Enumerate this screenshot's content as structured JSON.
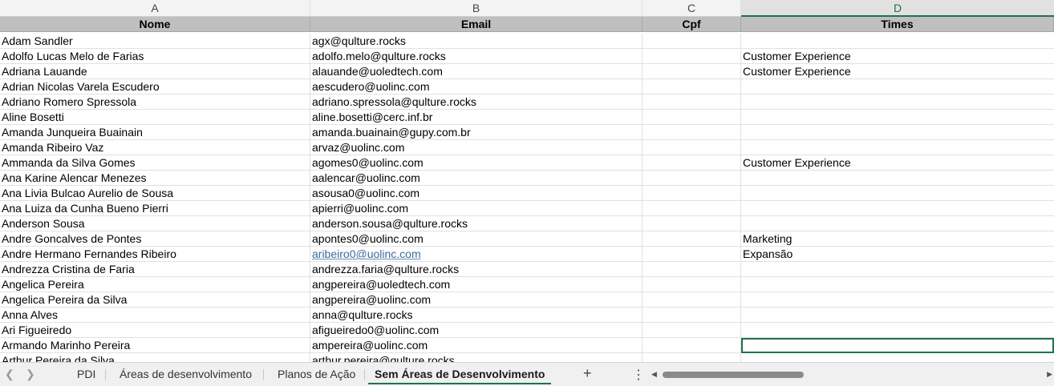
{
  "columns": [
    "A",
    "B",
    "C",
    "D"
  ],
  "header": {
    "nome": "Nome",
    "email": "Email",
    "cpf": "Cpf",
    "times": "Times"
  },
  "rows": [
    {
      "nome": "Adam Sandler",
      "email": "agx@qulture.rocks",
      "cpf": "",
      "times": ""
    },
    {
      "nome": "Adolfo Lucas Melo de Farias",
      "email": "adolfo.melo@qulture.rocks",
      "cpf": "",
      "times": "Customer Experience"
    },
    {
      "nome": "Adriana Lauande",
      "email": "alauande@uoledtech.com",
      "cpf": "",
      "times": "Customer Experience"
    },
    {
      "nome": "Adrian Nicolas Varela Escudero",
      "email": "aescudero@uolinc.com",
      "cpf": "",
      "times": ""
    },
    {
      "nome": "Adriano Romero Spressola",
      "email": "adriano.spressola@qulture.rocks",
      "cpf": "",
      "times": ""
    },
    {
      "nome": "Aline Bosetti",
      "email": "aline.bosetti@cerc.inf.br",
      "cpf": "",
      "times": ""
    },
    {
      "nome": "Amanda Junqueira Buainain",
      "email": "amanda.buainain@gupy.com.br",
      "cpf": "",
      "times": ""
    },
    {
      "nome": "Amanda Ribeiro Vaz",
      "email": "arvaz@uolinc.com",
      "cpf": "",
      "times": ""
    },
    {
      "nome": "Ammanda da Silva Gomes",
      "email": "agomes0@uolinc.com",
      "cpf": "",
      "times": "Customer Experience"
    },
    {
      "nome": "Ana Karine Alencar Menezes",
      "email": "aalencar@uolinc.com",
      "cpf": "",
      "times": ""
    },
    {
      "nome": "Ana Livia Bulcao Aurelio de Sousa",
      "email": "asousa0@uolinc.com",
      "cpf": "",
      "times": ""
    },
    {
      "nome": "Ana Luiza da Cunha Bueno Pierri",
      "email": "apierri@uolinc.com",
      "cpf": "",
      "times": ""
    },
    {
      "nome": "Anderson Sousa",
      "email": "anderson.sousa@qulture.rocks",
      "cpf": "",
      "times": ""
    },
    {
      "nome": "Andre Goncalves de Pontes",
      "email": "apontes0@uolinc.com",
      "cpf": "",
      "times": "Marketing"
    },
    {
      "nome": "Andre Hermano Fernandes Ribeiro",
      "email": "aribeiro0@uolinc.com",
      "cpf": "",
      "times": "Expansão"
    },
    {
      "nome": "Andrezza Cristina de Faria",
      "email": "andrezza.faria@qulture.rocks",
      "cpf": "",
      "times": ""
    },
    {
      "nome": "Angelica Pereira",
      "email": "angpereira@uoledtech.com",
      "cpf": "",
      "times": ""
    },
    {
      "nome": "Angelica Pereira da Silva",
      "email": "angpereira@uolinc.com",
      "cpf": "",
      "times": ""
    },
    {
      "nome": "Anna Alves",
      "email": "anna@qulture.rocks",
      "cpf": "",
      "times": ""
    },
    {
      "nome": "Ari Figueiredo",
      "email": "afigueiredo0@uolinc.com",
      "cpf": "",
      "times": ""
    },
    {
      "nome": "Armando Marinho Pereira",
      "email": "ampereira@uolinc.com",
      "cpf": "",
      "times": ""
    },
    {
      "nome": "Arthur Pereira da Silva",
      "email": "arthur.pereira@qulture.rocks",
      "cpf": "",
      "times": ""
    }
  ],
  "sheet_tabs": [
    "PDI",
    "Áreas de desenvolvimento",
    "Planos de Ação",
    "Sem Áreas de Desenvolvimento"
  ],
  "active_tab": "Sem Áreas de Desenvolvimento",
  "add_sheet_label": "+",
  "more_label": "⋮",
  "icons": {
    "prev": "chevron-left-icon",
    "next": "chevron-right-icon"
  },
  "colors": {
    "accent": "#217346",
    "header_fill": "#bfbfbf",
    "link": "#3b6b9c"
  }
}
